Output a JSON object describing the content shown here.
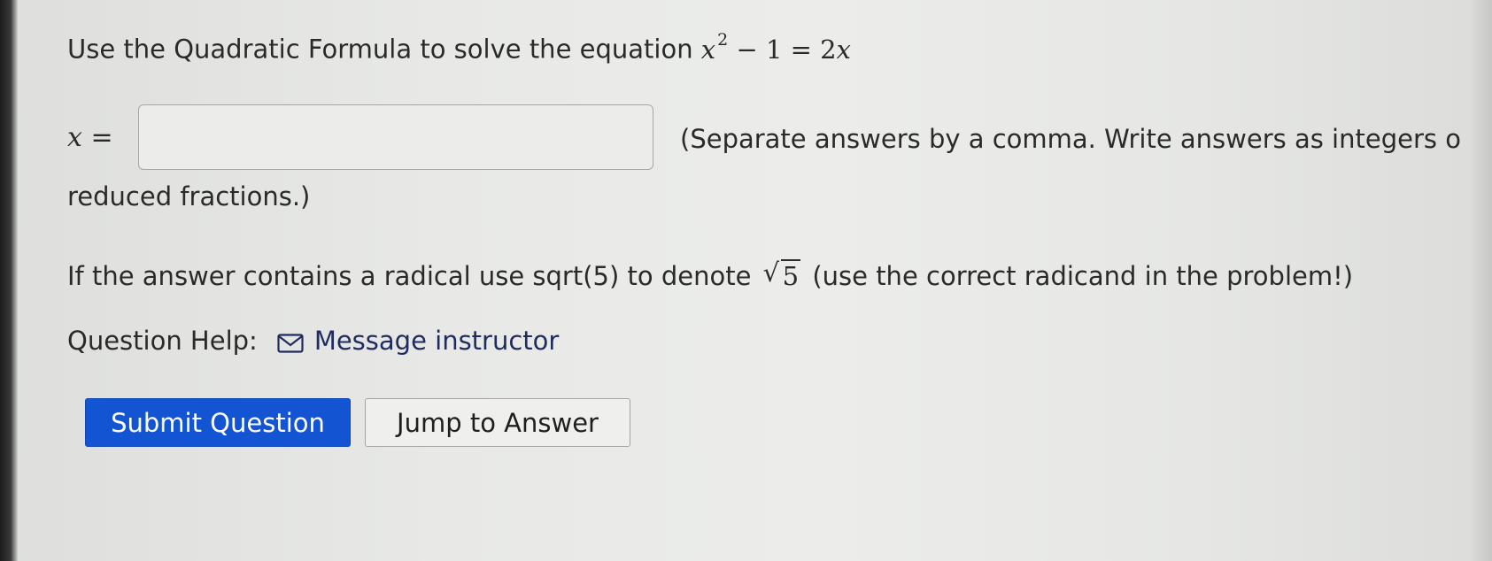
{
  "question": {
    "prompt_prefix": "Use the Quadratic Formula to solve the equation",
    "equation": {
      "base": "x",
      "exponent": "2",
      "rest": "− 1 = 2",
      "rest_var": "x"
    }
  },
  "answer": {
    "label": "x =",
    "value": "",
    "placeholder": ""
  },
  "instructions": {
    "hint_line1": "(Separate answers by a comma. Write answers as integers o",
    "hint_line2": "reduced fractions.)",
    "radical_prefix": "If the answer contains a radical use sqrt(5) to denote",
    "radical_sign": "√",
    "radicand": "5",
    "radical_suffix": "(use the correct radicand in the problem!)"
  },
  "help": {
    "label": "Question Help:",
    "icon": "mail-icon",
    "link_label": "Message instructor"
  },
  "buttons": {
    "submit_label": "Submit Question",
    "jump_label": "Jump to Answer"
  },
  "colors": {
    "primary_button": "#1354d3",
    "link": "#1f2c5e"
  }
}
